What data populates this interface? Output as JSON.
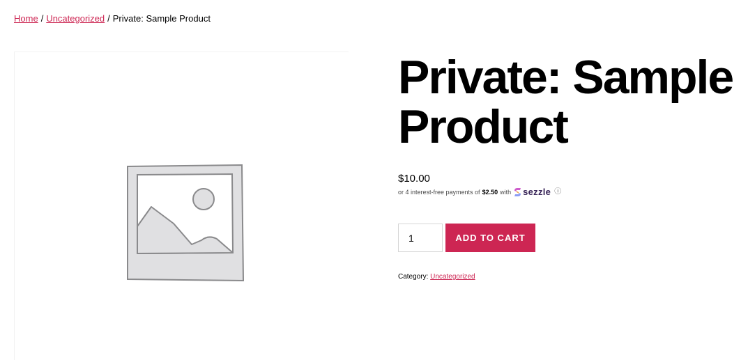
{
  "breadcrumb": {
    "home": "Home",
    "separator": "/",
    "category": "Uncategorized",
    "current": "Private: Sample Product"
  },
  "gallery": {
    "image_icon": "image-placeholder-icon"
  },
  "product": {
    "title_line1": "Private: Sample",
    "title_line2": "Product",
    "price": "$10.00"
  },
  "sezzle": {
    "prefix": "or 4 interest-free payments of",
    "amount": "$2.50",
    "with": "with",
    "brand": "sezzle",
    "info_icon": "ⓘ"
  },
  "cart": {
    "quantity": "1",
    "button_label": "ADD TO CART"
  },
  "meta": {
    "category_label": "Category:",
    "category_value": "Uncategorized"
  },
  "colors": {
    "accent": "#cd2653",
    "text": "#000000",
    "sezzle_brand": "#392558"
  }
}
